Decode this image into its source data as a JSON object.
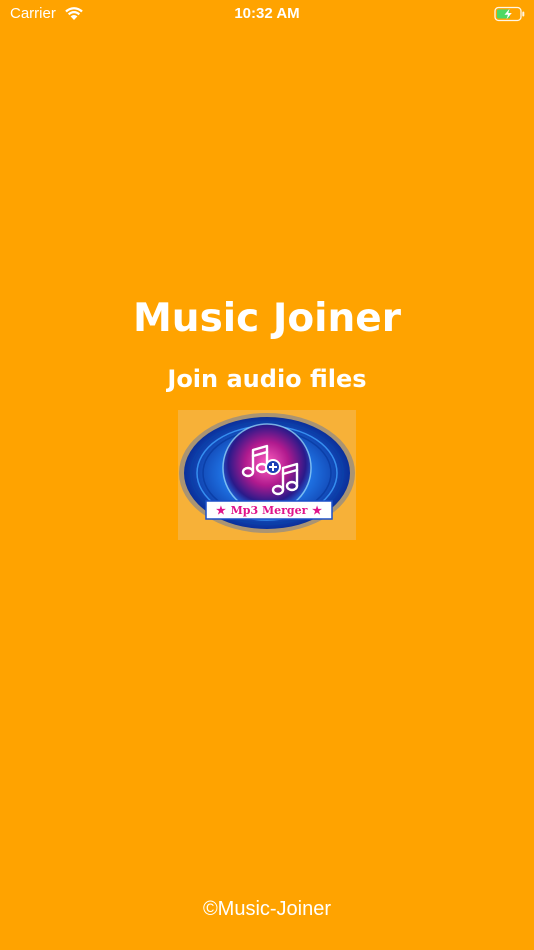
{
  "status_bar": {
    "carrier": "Carrier",
    "time": "10:32 AM",
    "wifi_icon": "wifi-icon",
    "battery_icon": "battery-charging-icon",
    "battery_color": "#4CD964"
  },
  "splash": {
    "title": "Music Joiner",
    "subtitle": "Join audio files",
    "logo": {
      "icon": "music-merge-logo-icon",
      "banner_text": "Mp3 Merger",
      "banner_star_left": "★",
      "banner_star_right": "★"
    },
    "copyright": "©Music-Joiner"
  },
  "colors": {
    "background": "#FFA300",
    "text": "#FFFFFF",
    "logo_blue": "#1E5FD8",
    "logo_pink": "#E0148A"
  }
}
